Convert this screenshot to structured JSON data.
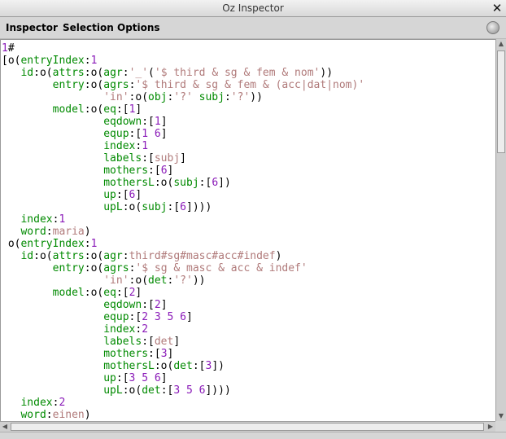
{
  "window": {
    "title": "Oz Inspector",
    "close_glyph": "✕"
  },
  "menubar": {
    "items": [
      "Inspector",
      "Selection",
      "Options"
    ],
    "status_icon": "status-lamp-icon"
  },
  "colors": {
    "feature": "#008a00",
    "number": "#8a1ab8",
    "atom": "#b07a7a",
    "text": "#000000",
    "background": "#ffffff"
  },
  "scrollbars": {
    "vertical": {
      "up": "▲",
      "down": "▼"
    },
    "horizontal": {
      "left": "◀",
      "right": "▶"
    }
  },
  "lines": [
    [
      [
        "n",
        "1"
      ],
      [
        "p",
        "#"
      ]
    ],
    [
      [
        "p",
        "[o("
      ],
      [
        "f",
        "entryIndex"
      ],
      [
        "p",
        ":"
      ],
      [
        "n",
        "1"
      ]
    ],
    [
      [
        "p",
        "   "
      ],
      [
        "f",
        "id"
      ],
      [
        "p",
        ":o("
      ],
      [
        "f",
        "attrs"
      ],
      [
        "p",
        ":o("
      ],
      [
        "f",
        "agr"
      ],
      [
        "p",
        ":"
      ],
      [
        "a",
        "'_'"
      ],
      [
        "p",
        "("
      ],
      [
        "a",
        "'$ third & sg & fem & nom'"
      ],
      [
        "p",
        "))"
      ]
    ],
    [
      [
        "p",
        "        "
      ],
      [
        "f",
        "entry"
      ],
      [
        "p",
        ":o("
      ],
      [
        "f",
        "agrs"
      ],
      [
        "p",
        ":"
      ],
      [
        "a",
        "'$ third & sg & fem & (acc|dat|nom)'"
      ]
    ],
    [
      [
        "p",
        "                "
      ],
      [
        "a",
        "'in'"
      ],
      [
        "p",
        ":o("
      ],
      [
        "f",
        "obj"
      ],
      [
        "p",
        ":"
      ],
      [
        "a",
        "'?'"
      ],
      [
        "p",
        " "
      ],
      [
        "f",
        "subj"
      ],
      [
        "p",
        ":"
      ],
      [
        "a",
        "'?'"
      ],
      [
        "p",
        "))"
      ]
    ],
    [
      [
        "p",
        "        "
      ],
      [
        "f",
        "model"
      ],
      [
        "p",
        ":o("
      ],
      [
        "f",
        "eq"
      ],
      [
        "p",
        ":["
      ],
      [
        "n",
        "1"
      ],
      [
        "p",
        "]"
      ]
    ],
    [
      [
        "p",
        "                "
      ],
      [
        "f",
        "eqdown"
      ],
      [
        "p",
        ":["
      ],
      [
        "n",
        "1"
      ],
      [
        "p",
        "]"
      ]
    ],
    [
      [
        "p",
        "                "
      ],
      [
        "f",
        "equp"
      ],
      [
        "p",
        ":["
      ],
      [
        "n",
        "1 6"
      ],
      [
        "p",
        "]"
      ]
    ],
    [
      [
        "p",
        "                "
      ],
      [
        "f",
        "index"
      ],
      [
        "p",
        ":"
      ],
      [
        "n",
        "1"
      ]
    ],
    [
      [
        "p",
        "                "
      ],
      [
        "f",
        "labels"
      ],
      [
        "p",
        ":["
      ],
      [
        "a",
        "subj"
      ],
      [
        "p",
        "]"
      ]
    ],
    [
      [
        "p",
        "                "
      ],
      [
        "f",
        "mothers"
      ],
      [
        "p",
        ":["
      ],
      [
        "n",
        "6"
      ],
      [
        "p",
        "]"
      ]
    ],
    [
      [
        "p",
        "                "
      ],
      [
        "f",
        "mothersL"
      ],
      [
        "p",
        ":o("
      ],
      [
        "f",
        "subj"
      ],
      [
        "p",
        ":["
      ],
      [
        "n",
        "6"
      ],
      [
        "p",
        "])"
      ]
    ],
    [
      [
        "p",
        "                "
      ],
      [
        "f",
        "up"
      ],
      [
        "p",
        ":["
      ],
      [
        "n",
        "6"
      ],
      [
        "p",
        "]"
      ]
    ],
    [
      [
        "p",
        "                "
      ],
      [
        "f",
        "upL"
      ],
      [
        "p",
        ":o("
      ],
      [
        "f",
        "subj"
      ],
      [
        "p",
        ":["
      ],
      [
        "n",
        "6"
      ],
      [
        "p",
        "])))"
      ]
    ],
    [
      [
        "p",
        "   "
      ],
      [
        "f",
        "index"
      ],
      [
        "p",
        ":"
      ],
      [
        "n",
        "1"
      ]
    ],
    [
      [
        "p",
        "   "
      ],
      [
        "f",
        "word"
      ],
      [
        "p",
        ":"
      ],
      [
        "a",
        "maria"
      ],
      [
        "p",
        ")"
      ]
    ],
    [
      [
        "p",
        " o("
      ],
      [
        "f",
        "entryIndex"
      ],
      [
        "p",
        ":"
      ],
      [
        "n",
        "1"
      ]
    ],
    [
      [
        "p",
        "   "
      ],
      [
        "f",
        "id"
      ],
      [
        "p",
        ":o("
      ],
      [
        "f",
        "attrs"
      ],
      [
        "p",
        ":o("
      ],
      [
        "f",
        "agr"
      ],
      [
        "p",
        ":"
      ],
      [
        "a",
        "third#sg#masc#acc#indef"
      ],
      [
        "p",
        ")"
      ]
    ],
    [
      [
        "p",
        "        "
      ],
      [
        "f",
        "entry"
      ],
      [
        "p",
        ":o("
      ],
      [
        "f",
        "agrs"
      ],
      [
        "p",
        ":"
      ],
      [
        "a",
        "'$ sg & masc & acc & indef'"
      ]
    ],
    [
      [
        "p",
        "                "
      ],
      [
        "a",
        "'in'"
      ],
      [
        "p",
        ":o("
      ],
      [
        "f",
        "det"
      ],
      [
        "p",
        ":"
      ],
      [
        "a",
        "'?'"
      ],
      [
        "p",
        "))"
      ]
    ],
    [
      [
        "p",
        "        "
      ],
      [
        "f",
        "model"
      ],
      [
        "p",
        ":o("
      ],
      [
        "f",
        "eq"
      ],
      [
        "p",
        ":["
      ],
      [
        "n",
        "2"
      ],
      [
        "p",
        "]"
      ]
    ],
    [
      [
        "p",
        "                "
      ],
      [
        "f",
        "eqdown"
      ],
      [
        "p",
        ":["
      ],
      [
        "n",
        "2"
      ],
      [
        "p",
        "]"
      ]
    ],
    [
      [
        "p",
        "                "
      ],
      [
        "f",
        "equp"
      ],
      [
        "p",
        ":["
      ],
      [
        "n",
        "2 3 5 6"
      ],
      [
        "p",
        "]"
      ]
    ],
    [
      [
        "p",
        "                "
      ],
      [
        "f",
        "index"
      ],
      [
        "p",
        ":"
      ],
      [
        "n",
        "2"
      ]
    ],
    [
      [
        "p",
        "                "
      ],
      [
        "f",
        "labels"
      ],
      [
        "p",
        ":["
      ],
      [
        "a",
        "det"
      ],
      [
        "p",
        "]"
      ]
    ],
    [
      [
        "p",
        "                "
      ],
      [
        "f",
        "mothers"
      ],
      [
        "p",
        ":["
      ],
      [
        "n",
        "3"
      ],
      [
        "p",
        "]"
      ]
    ],
    [
      [
        "p",
        "                "
      ],
      [
        "f",
        "mothersL"
      ],
      [
        "p",
        ":o("
      ],
      [
        "f",
        "det"
      ],
      [
        "p",
        ":["
      ],
      [
        "n",
        "3"
      ],
      [
        "p",
        "])"
      ]
    ],
    [
      [
        "p",
        "                "
      ],
      [
        "f",
        "up"
      ],
      [
        "p",
        ":["
      ],
      [
        "n",
        "3 5 6"
      ],
      [
        "p",
        "]"
      ]
    ],
    [
      [
        "p",
        "                "
      ],
      [
        "f",
        "upL"
      ],
      [
        "p",
        ":o("
      ],
      [
        "f",
        "det"
      ],
      [
        "p",
        ":["
      ],
      [
        "n",
        "3 5 6"
      ],
      [
        "p",
        "])))"
      ]
    ],
    [
      [
        "p",
        "   "
      ],
      [
        "f",
        "index"
      ],
      [
        "p",
        ":"
      ],
      [
        "n",
        "2"
      ]
    ],
    [
      [
        "p",
        "   "
      ],
      [
        "f",
        "word"
      ],
      [
        "p",
        ":"
      ],
      [
        "a",
        "einen"
      ],
      [
        "p",
        ")"
      ]
    ]
  ]
}
